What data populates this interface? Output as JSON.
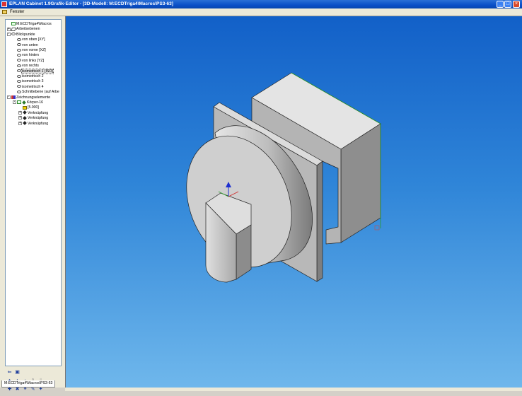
{
  "window": {
    "title": "EPLAN Cabinet 1.9Grafik-Editor - [3D-Modell: M:ECDTriga4\\Macros\\PS3-63]",
    "min_symbol": "_",
    "max_symbol": "□",
    "close_symbol": "×"
  },
  "menubar": {
    "items": [
      {
        "label": "Fenster",
        "icon": "window-menu-icon"
      }
    ]
  },
  "tree": {
    "items": [
      {
        "label": "M:ECDTriga4\\Macros",
        "indent": 0,
        "icon": "check",
        "expander": ""
      },
      {
        "label": "Arbeitsebenen",
        "indent": 0,
        "icon": "plane",
        "expander": "+"
      },
      {
        "label": "Blickpunkte",
        "indent": 0,
        "icon": "eye",
        "expander": "-"
      },
      {
        "label": "von oben [XY]",
        "indent": 1,
        "icon": "eye",
        "expander": ""
      },
      {
        "label": "von unten",
        "indent": 1,
        "icon": "eye",
        "expander": ""
      },
      {
        "label": "von vorne [XZ]",
        "indent": 1,
        "icon": "eye",
        "expander": ""
      },
      {
        "label": "von hinten",
        "indent": 1,
        "icon": "eye",
        "expander": ""
      },
      {
        "label": "von links [YZ]",
        "indent": 1,
        "icon": "eye",
        "expander": ""
      },
      {
        "label": "von rechts",
        "indent": 1,
        "icon": "eye",
        "expander": ""
      },
      {
        "label": "isometrisch 1 [ISO]",
        "indent": 1,
        "icon": "eye",
        "expander": "",
        "selected": true
      },
      {
        "label": "isometrisch 2",
        "indent": 1,
        "icon": "eye",
        "expander": ""
      },
      {
        "label": "isometrisch 3",
        "indent": 1,
        "icon": "eye",
        "expander": ""
      },
      {
        "label": "isometrisch 4",
        "indent": 1,
        "icon": "eye",
        "expander": ""
      },
      {
        "label": "Schnittebene (auf Arbe",
        "indent": 1,
        "icon": "eye",
        "expander": ""
      },
      {
        "label": "Zeichnungselemente",
        "indent": 0,
        "icon": "shapes",
        "expander": "-"
      },
      {
        "label": "Körper-16",
        "indent": 1,
        "icon": "diamond",
        "expander": "-",
        "has_check": true
      },
      {
        "label": "[5.000]",
        "indent": 2,
        "icon": "box",
        "expander": ""
      },
      {
        "label": "Verknüpfung",
        "indent": 2,
        "icon": "star",
        "expander": "+"
      },
      {
        "label": "Verknüpfung",
        "indent": 2,
        "icon": "star",
        "expander": "+"
      },
      {
        "label": "Verknüpfung",
        "indent": 2,
        "icon": "star",
        "expander": "+"
      }
    ]
  },
  "toolbar": {
    "buttons": [
      {
        "name": "back-arrow-icon",
        "glyph": "⇐",
        "row": 0,
        "col": 0
      },
      {
        "name": "save-view-icon",
        "glyph": "▣",
        "row": 0,
        "col": 1
      },
      {
        "name": "binoculars-icon",
        "glyph": "♠",
        "row": 1,
        "col": 0
      },
      {
        "name": "move-up-icon",
        "glyph": "↑",
        "row": 1,
        "col": 1
      },
      {
        "name": "move-down-icon",
        "glyph": "↓",
        "row": 1,
        "col": 2
      },
      {
        "name": "move-top-icon",
        "glyph": "⇑",
        "row": 1,
        "col": 3,
        "dim": true
      },
      {
        "name": "move-bottom-icon",
        "glyph": "⇓",
        "row": 1,
        "col": 4,
        "dim": true
      },
      {
        "name": "add-link-icon",
        "glyph": "✚",
        "row": 2,
        "col": 0
      },
      {
        "name": "delete-icon",
        "glyph": "✖",
        "row": 2,
        "col": 1
      },
      {
        "name": "link-icon",
        "glyph": "⚭",
        "row": 2,
        "col": 2
      },
      {
        "name": "edit-icon",
        "glyph": "✎",
        "row": 2,
        "col": 3
      },
      {
        "name": "properties-icon",
        "glyph": "✦",
        "row": 2,
        "col": 4
      }
    ]
  },
  "tabs": [
    {
      "label": "M:ECDTriga4\\Macros\\PS3-63"
    }
  ],
  "colors": {
    "title_bar": "#0a4fc8",
    "viewport_top": "#1260c8",
    "viewport_bottom": "#70b8ec",
    "model_light": "#dcdcdc",
    "model_mid": "#b4b4b4",
    "model_dark": "#8a8a8a"
  }
}
